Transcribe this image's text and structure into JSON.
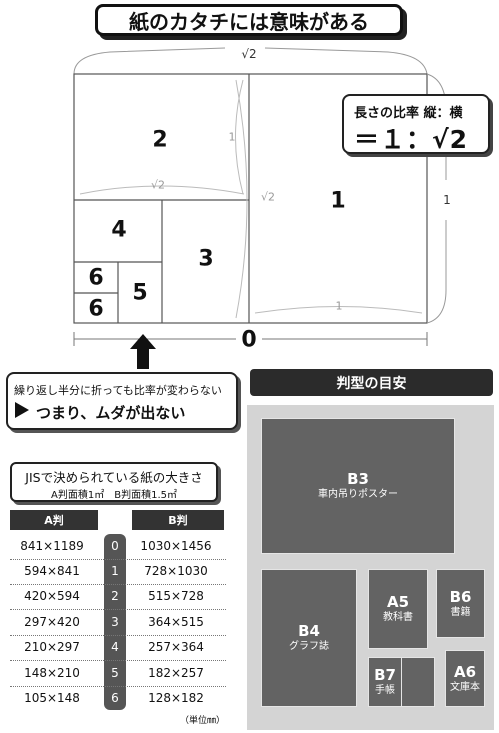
{
  "title": "紙のカタチには意味がある",
  "ratio": {
    "label": "長さの比率 縦：横",
    "value": "＝１：√2"
  },
  "diagram": {
    "rect_labels": [
      "2",
      "1",
      "4",
      "3",
      "6",
      "6",
      "5"
    ],
    "bottom_label": "0",
    "sqrt2_top": "√2",
    "sqrt2_mid": "√2",
    "sqrt2_vert": "√2",
    "one_inner_left": "1",
    "one_right": "1",
    "one_bottom": "1"
  },
  "message": {
    "line1": "繰り返し半分に折っても比率が変わらない",
    "line2": "つまり、ムダが出ない"
  },
  "jis": {
    "title": "JISで決められている紙の大きさ",
    "subtitle": "A判面積1㎡　B判面積1.5㎡",
    "col_a": "A判",
    "col_b": "B判",
    "rows": [
      {
        "a": "841×1189",
        "n": "0",
        "b": "1030×1456"
      },
      {
        "a": "594×841",
        "n": "1",
        "b": "728×1030"
      },
      {
        "a": "420×594",
        "n": "2",
        "b": "515×728"
      },
      {
        "a": "297×420",
        "n": "3",
        "b": "364×515"
      },
      {
        "a": "210×297",
        "n": "4",
        "b": "257×364"
      },
      {
        "a": "148×210",
        "n": "5",
        "b": "182×257"
      },
      {
        "a": "105×148",
        "n": "6",
        "b": "128×182"
      }
    ],
    "unit": "（単位㎜）"
  },
  "guide": {
    "title": "判型の目安",
    "items": [
      {
        "name": "B3",
        "desc": "車内吊りポスター"
      },
      {
        "name": "B4",
        "desc": "グラフ誌"
      },
      {
        "name": "A5",
        "desc": "教科書"
      },
      {
        "name": "B6",
        "desc": "書籍"
      },
      {
        "name": "B7",
        "desc": "手帳"
      },
      {
        "name": "A6",
        "desc": "文庫本"
      }
    ]
  }
}
